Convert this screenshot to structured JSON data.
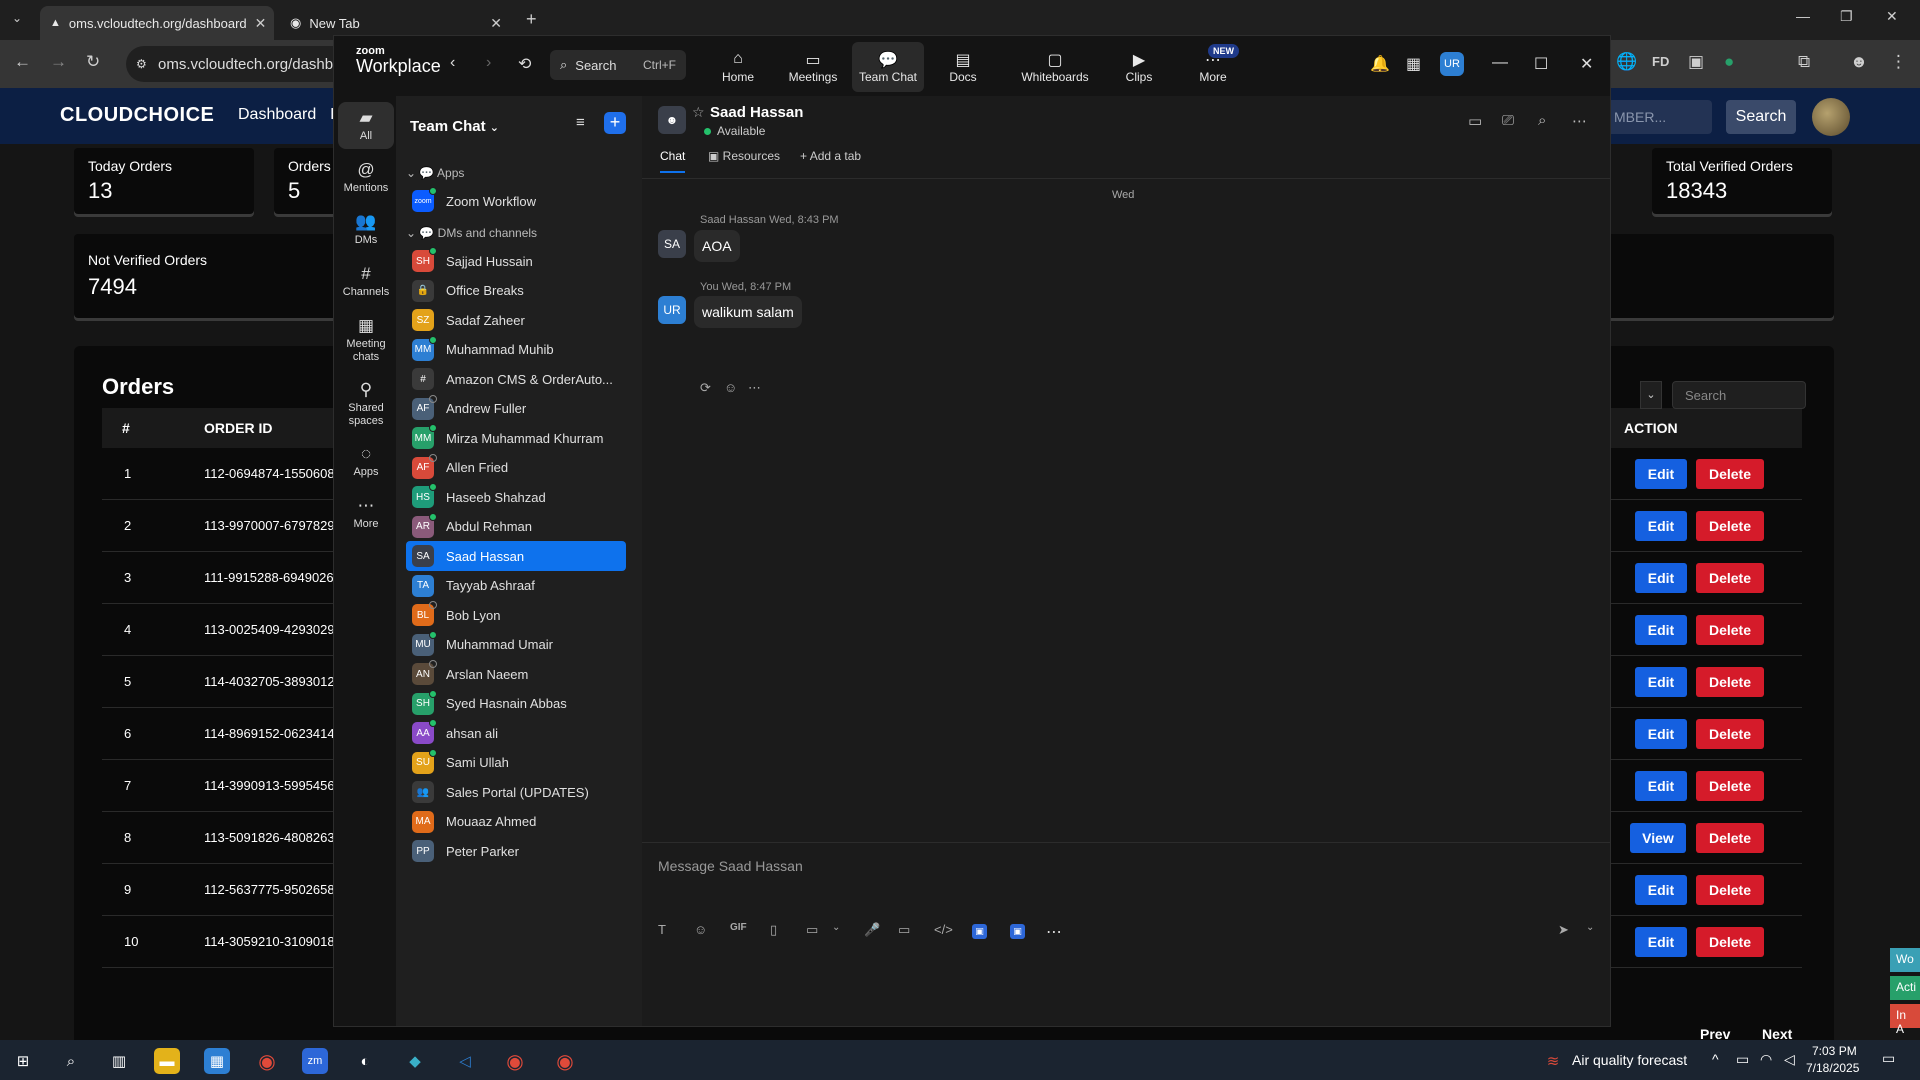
{
  "browser": {
    "tabs": [
      {
        "title": "oms.vcloudtech.org/dashboard",
        "active": true
      },
      {
        "title": "New Tab",
        "active": false
      }
    ],
    "url": "oms.vcloudtech.org/dashbo"
  },
  "site": {
    "logo": "CLOUDCHOICE",
    "nav": [
      "Dashboard",
      "I"
    ],
    "search_placeholder": "MBER...",
    "search_button": "Search",
    "cards": [
      {
        "label": "Today Orders",
        "value": "13"
      },
      {
        "label": "Orders I",
        "value": "5"
      },
      {
        "label": "Total Verified Orders",
        "value": "18343"
      },
      {
        "label": "Not Verified Orders",
        "value": "7494"
      }
    ],
    "orders": {
      "title": "Orders",
      "search_placeholder": "Search",
      "columns": [
        "#",
        "ORDER ID",
        "ACTION"
      ],
      "rows": [
        {
          "num": "1",
          "id": "112-0694874-1550608",
          "primary": "Edit"
        },
        {
          "num": "2",
          "id": "113-9970007-6797829",
          "primary": "Edit"
        },
        {
          "num": "3",
          "id": "111-9915288-6949026",
          "primary": "Edit"
        },
        {
          "num": "4",
          "id": "113-0025409-4293029",
          "primary": "Edit"
        },
        {
          "num": "5",
          "id": "114-4032705-3893012",
          "primary": "Edit"
        },
        {
          "num": "6",
          "id": "114-8969152-0623414",
          "primary": "Edit"
        },
        {
          "num": "7",
          "id": "114-3990913-5995456",
          "primary": "Edit"
        },
        {
          "num": "8",
          "id": "113-5091826-4808263",
          "primary": "View"
        },
        {
          "num": "9",
          "id": "112-5637775-9502658",
          "primary": "Edit"
        },
        {
          "num": "10",
          "id": "114-3059210-3109018",
          "primary": "Edit"
        }
      ],
      "delete_label": "Delete",
      "prev_label": "Prev",
      "next_label": "Next"
    },
    "side_badges": [
      "Wo",
      "Acti",
      "In A"
    ]
  },
  "zoom": {
    "brand_small": "zoom",
    "brand_big": "Workplace",
    "search_label": "Search",
    "search_shortcut": "Ctrl+F",
    "nav": [
      "Home",
      "Meetings",
      "Team Chat",
      "Docs",
      "Whiteboards",
      "Clips",
      "More"
    ],
    "new_badge": "NEW",
    "user_initials": "UR",
    "rail": [
      "All",
      "Mentions",
      "DMs",
      "Channels",
      "Meeting chats",
      "Shared spaces",
      "Apps",
      "More"
    ],
    "list_title": "Team Chat",
    "sec_apps": "Apps",
    "sec_dms": "DMs and channels",
    "apps": [
      {
        "name": "Zoom Workflow",
        "initials": "zoom",
        "color": "#0b5cff"
      }
    ],
    "chats": [
      {
        "name": "Sajjad Hussain",
        "initials": "SH",
        "color": "#d84a3a",
        "status": "on"
      },
      {
        "name": "Office Breaks",
        "initials": "🔒",
        "color": "#3a3a3a",
        "status": "none"
      },
      {
        "name": "Sadaf Zaheer",
        "initials": "SZ",
        "color": "#e3a21a",
        "status": "none"
      },
      {
        "name": "Muhammad Muhib",
        "initials": "MM",
        "color": "#2d7fd3",
        "status": "on"
      },
      {
        "name": "Amazon CMS & OrderAuto...",
        "initials": "#",
        "color": "#3a3a3a",
        "status": "none"
      },
      {
        "name": "Andrew Fuller",
        "initials": "AF",
        "color": "#4a6078",
        "status": "off"
      },
      {
        "name": "Mirza Muhammad Khurram",
        "initials": "MM",
        "color": "#27a06a",
        "status": "on"
      },
      {
        "name": "Allen Fried",
        "initials": "AF",
        "color": "#d84a3a",
        "status": "off"
      },
      {
        "name": "Haseeb Shahzad",
        "initials": "HS",
        "color": "#1e9c7a",
        "status": "on"
      },
      {
        "name": "Abdul Rehman",
        "initials": "AR",
        "color": "#8a5a7a",
        "status": "on"
      },
      {
        "name": "Saad Hassan",
        "initials": "SA",
        "color": "#3a3f4a",
        "status": "none"
      },
      {
        "name": "Tayyab Ashraaf",
        "initials": "TA",
        "color": "#2d7fd3",
        "status": "none"
      },
      {
        "name": "Bob Lyon",
        "initials": "BL",
        "color": "#e06b1a",
        "status": "off"
      },
      {
        "name": "Muhammad Umair",
        "initials": "MU",
        "color": "#4a6078",
        "status": "on"
      },
      {
        "name": "Arslan Naeem",
        "initials": "AN",
        "color": "#5a4a3a",
        "status": "off"
      },
      {
        "name": "Syed Hasnain Abbas",
        "initials": "SH",
        "color": "#27a06a",
        "status": "on"
      },
      {
        "name": "ahsan ali",
        "initials": "AA",
        "color": "#8a4ac8",
        "status": "on"
      },
      {
        "name": "Sami Ullah",
        "initials": "SU",
        "color": "#e3a21a",
        "status": "on"
      },
      {
        "name": "Sales Portal (UPDATES)",
        "initials": "👥",
        "color": "#3a3a3a",
        "status": "none"
      },
      {
        "name": "Mouaaz Ahmed",
        "initials": "MA",
        "color": "#e06b1a",
        "status": "none"
      },
      {
        "name": "Peter Parker",
        "initials": "PP",
        "color": "#4a6078",
        "status": "none"
      }
    ],
    "selected_index": 10,
    "chat": {
      "name": "Saad Hassan",
      "status": "Available",
      "tabs": [
        "Chat",
        "Resources",
        "Add a tab"
      ],
      "day": "Wed",
      "messages": [
        {
          "meta": "Saad Hassan Wed, 8:43 PM",
          "text": "AOA",
          "avatar": "SA",
          "color": "#3a3f4a"
        },
        {
          "meta": "You Wed, 8:47 PM",
          "text": "walikum salam",
          "avatar": "UR",
          "color": "#2d7fd3"
        }
      ],
      "composer_placeholder": "Message Saad Hassan"
    }
  },
  "taskbar": {
    "weather": "Air quality forecast",
    "time": "7:03 PM",
    "date": "7/18/2025"
  }
}
